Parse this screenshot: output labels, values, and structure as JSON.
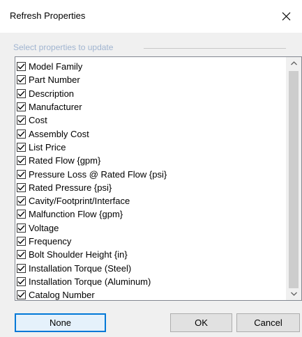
{
  "window": {
    "title": "Refresh Properties"
  },
  "group": {
    "label": "Select properties to update"
  },
  "properties": [
    {
      "label": "Model Family",
      "checked": true
    },
    {
      "label": "Part Number",
      "checked": true
    },
    {
      "label": "Description",
      "checked": true
    },
    {
      "label": "Manufacturer",
      "checked": true
    },
    {
      "label": "Cost",
      "checked": true
    },
    {
      "label": "Assembly Cost",
      "checked": true
    },
    {
      "label": "List Price",
      "checked": true
    },
    {
      "label": "Rated Flow {gpm}",
      "checked": true
    },
    {
      "label": "Pressure Loss @ Rated Flow {psi}",
      "checked": true
    },
    {
      "label": "Rated Pressure {psi}",
      "checked": true
    },
    {
      "label": "Cavity/Footprint/Interface",
      "checked": true
    },
    {
      "label": "Malfunction Flow {gpm}",
      "checked": true
    },
    {
      "label": "Voltage",
      "checked": true
    },
    {
      "label": "Frequency",
      "checked": true
    },
    {
      "label": "Bolt Shoulder Height {in}",
      "checked": true
    },
    {
      "label": "Installation Torque (Steel)",
      "checked": true
    },
    {
      "label": "Installation Torque (Aluminum)",
      "checked": true
    },
    {
      "label": "Catalog Number",
      "checked": true
    }
  ],
  "buttons": {
    "none_label": "None",
    "ok_label": "OK",
    "cancel_label": "Cancel"
  },
  "icons": {
    "close": "close-icon",
    "checkbox": "checkmark-icon",
    "scroll_up": "chevron-up-icon",
    "scroll_down": "chevron-down-icon"
  },
  "colors": {
    "group_label": "#a0b4d0",
    "focus_border": "#0078d7",
    "dialog_background": "#f0f0f0"
  }
}
